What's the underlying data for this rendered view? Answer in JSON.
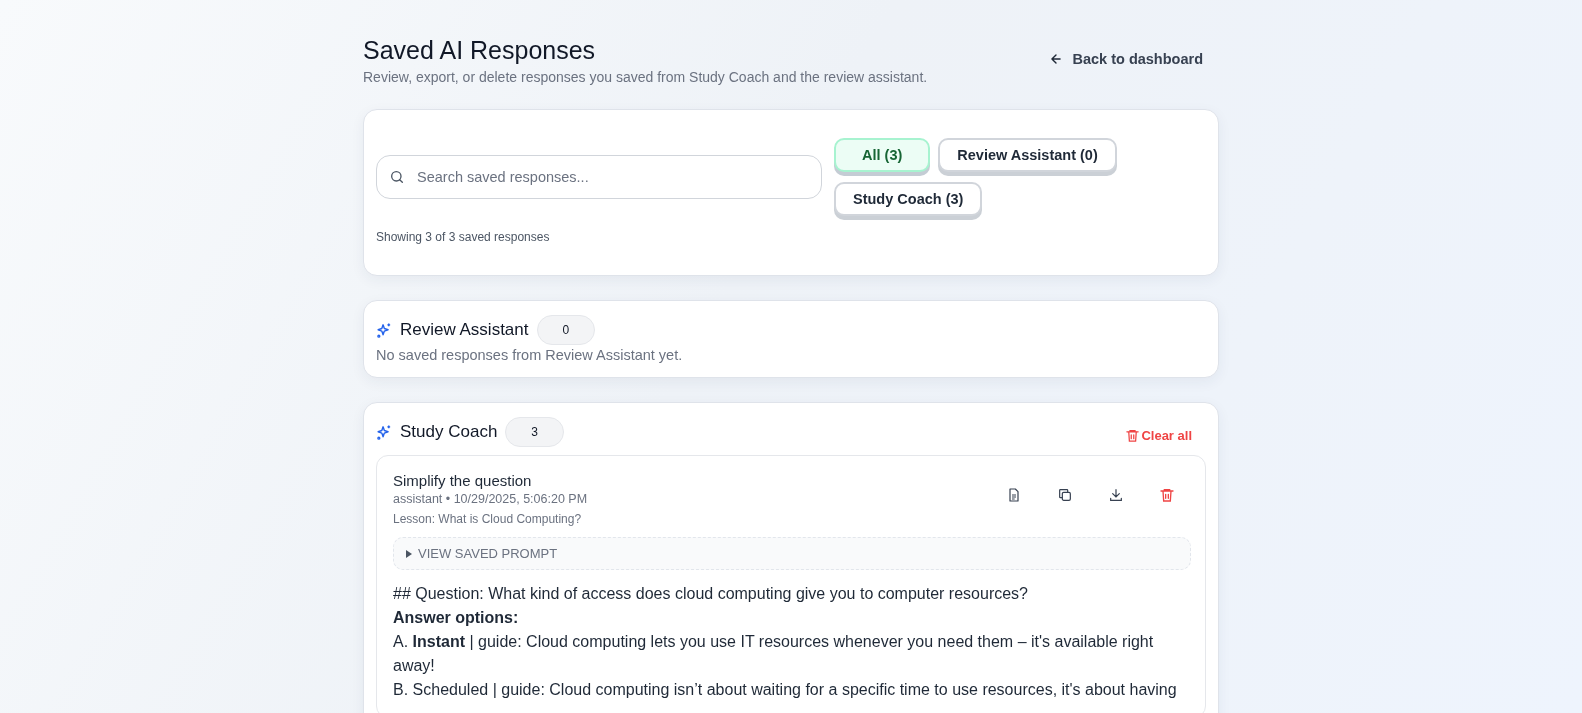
{
  "header": {
    "title": "Saved AI Responses",
    "subtitle": "Review, export, or delete responses you saved from Study Coach and the review assistant.",
    "back_link": "Back to dashboard"
  },
  "search": {
    "placeholder": "Search saved responses..."
  },
  "filters": [
    {
      "label": "All (3)",
      "selected": true
    },
    {
      "label": "Review Assistant (0)",
      "selected": false
    },
    {
      "label": "Study Coach (3)",
      "selected": false
    }
  ],
  "showing": "Showing 3 of 3 saved responses",
  "sections": [
    {
      "name": "Review Assistant",
      "count": "0",
      "empty_text": "No saved responses from Review Assistant yet."
    },
    {
      "name": "Study Coach",
      "count": "3",
      "clear_label": "Clear all",
      "items": [
        {
          "title": "Simplify the question",
          "meta": "assistant • 10/29/2025, 5:06:20 PM",
          "lesson": "Lesson: What is Cloud Computing?",
          "prompt_toggle": "VIEW SAVED PROMPT",
          "expanded": false,
          "content": [
            {
              "kind": "text",
              "text": "## Question: What kind of access does cloud computing give you to computer resources?"
            },
            {
              "kind": "heading",
              "text": "Answer options:"
            },
            {
              "kind": "text",
              "text": "A. **Instant** | guide: Cloud computing lets you use IT resources whenever you need them – it's available right away!"
            },
            {
              "kind": "text",
              "text": "B. Scheduled | guide: Cloud computing isn’t about waiting for a specific time to use resources, it's about having"
            }
          ]
        }
      ]
    }
  ]
}
